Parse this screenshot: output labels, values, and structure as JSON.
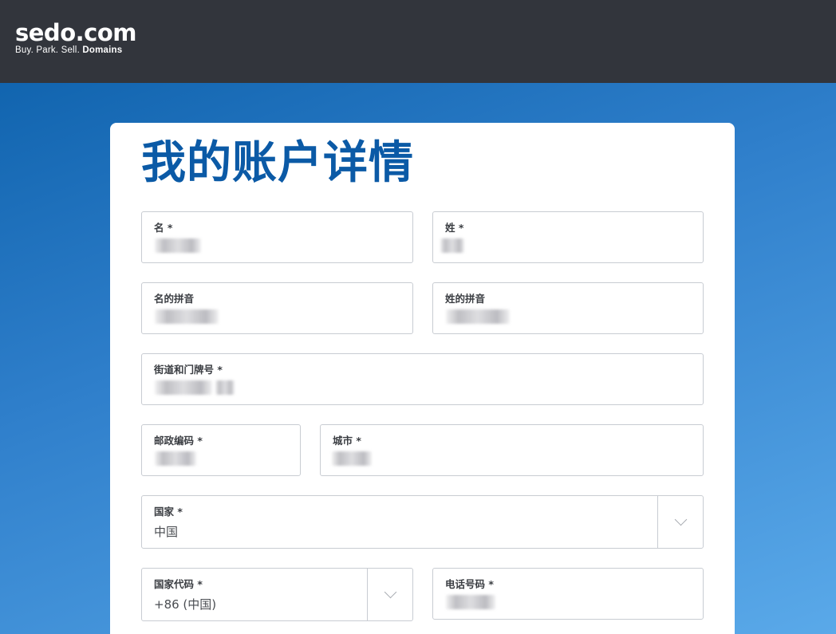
{
  "brand": {
    "name": "sedo.com",
    "tagline_prefix": "Buy.  Park.  Sell.",
    "tagline_strong": "Domains"
  },
  "page": {
    "title": "我的账户详情"
  },
  "form": {
    "first_name": {
      "label": "名 *",
      "value": ""
    },
    "last_name": {
      "label": "姓 *",
      "value": ""
    },
    "first_name_pinyin": {
      "label": "名的拼音",
      "value": ""
    },
    "last_name_pinyin": {
      "label": "姓的拼音",
      "value": ""
    },
    "street": {
      "label": "街道和门牌号 *",
      "value": ""
    },
    "postal_code": {
      "label": "邮政编码 *",
      "value": ""
    },
    "city": {
      "label": "城市 *",
      "value": ""
    },
    "country": {
      "label": "国家 *",
      "value": "中国"
    },
    "country_code": {
      "label": "国家代码 *",
      "value": "+86 (中国)"
    },
    "phone": {
      "label": "电话号码 *",
      "value": ""
    }
  },
  "colors": {
    "topbar": "#32353c",
    "title": "#0b5aa6",
    "background_start": "#0a5ea8",
    "background_end": "#5aa9e9"
  },
  "icons": {
    "country_dropdown": "chevron-down-icon",
    "country_code_dropdown": "chevron-down-icon"
  }
}
